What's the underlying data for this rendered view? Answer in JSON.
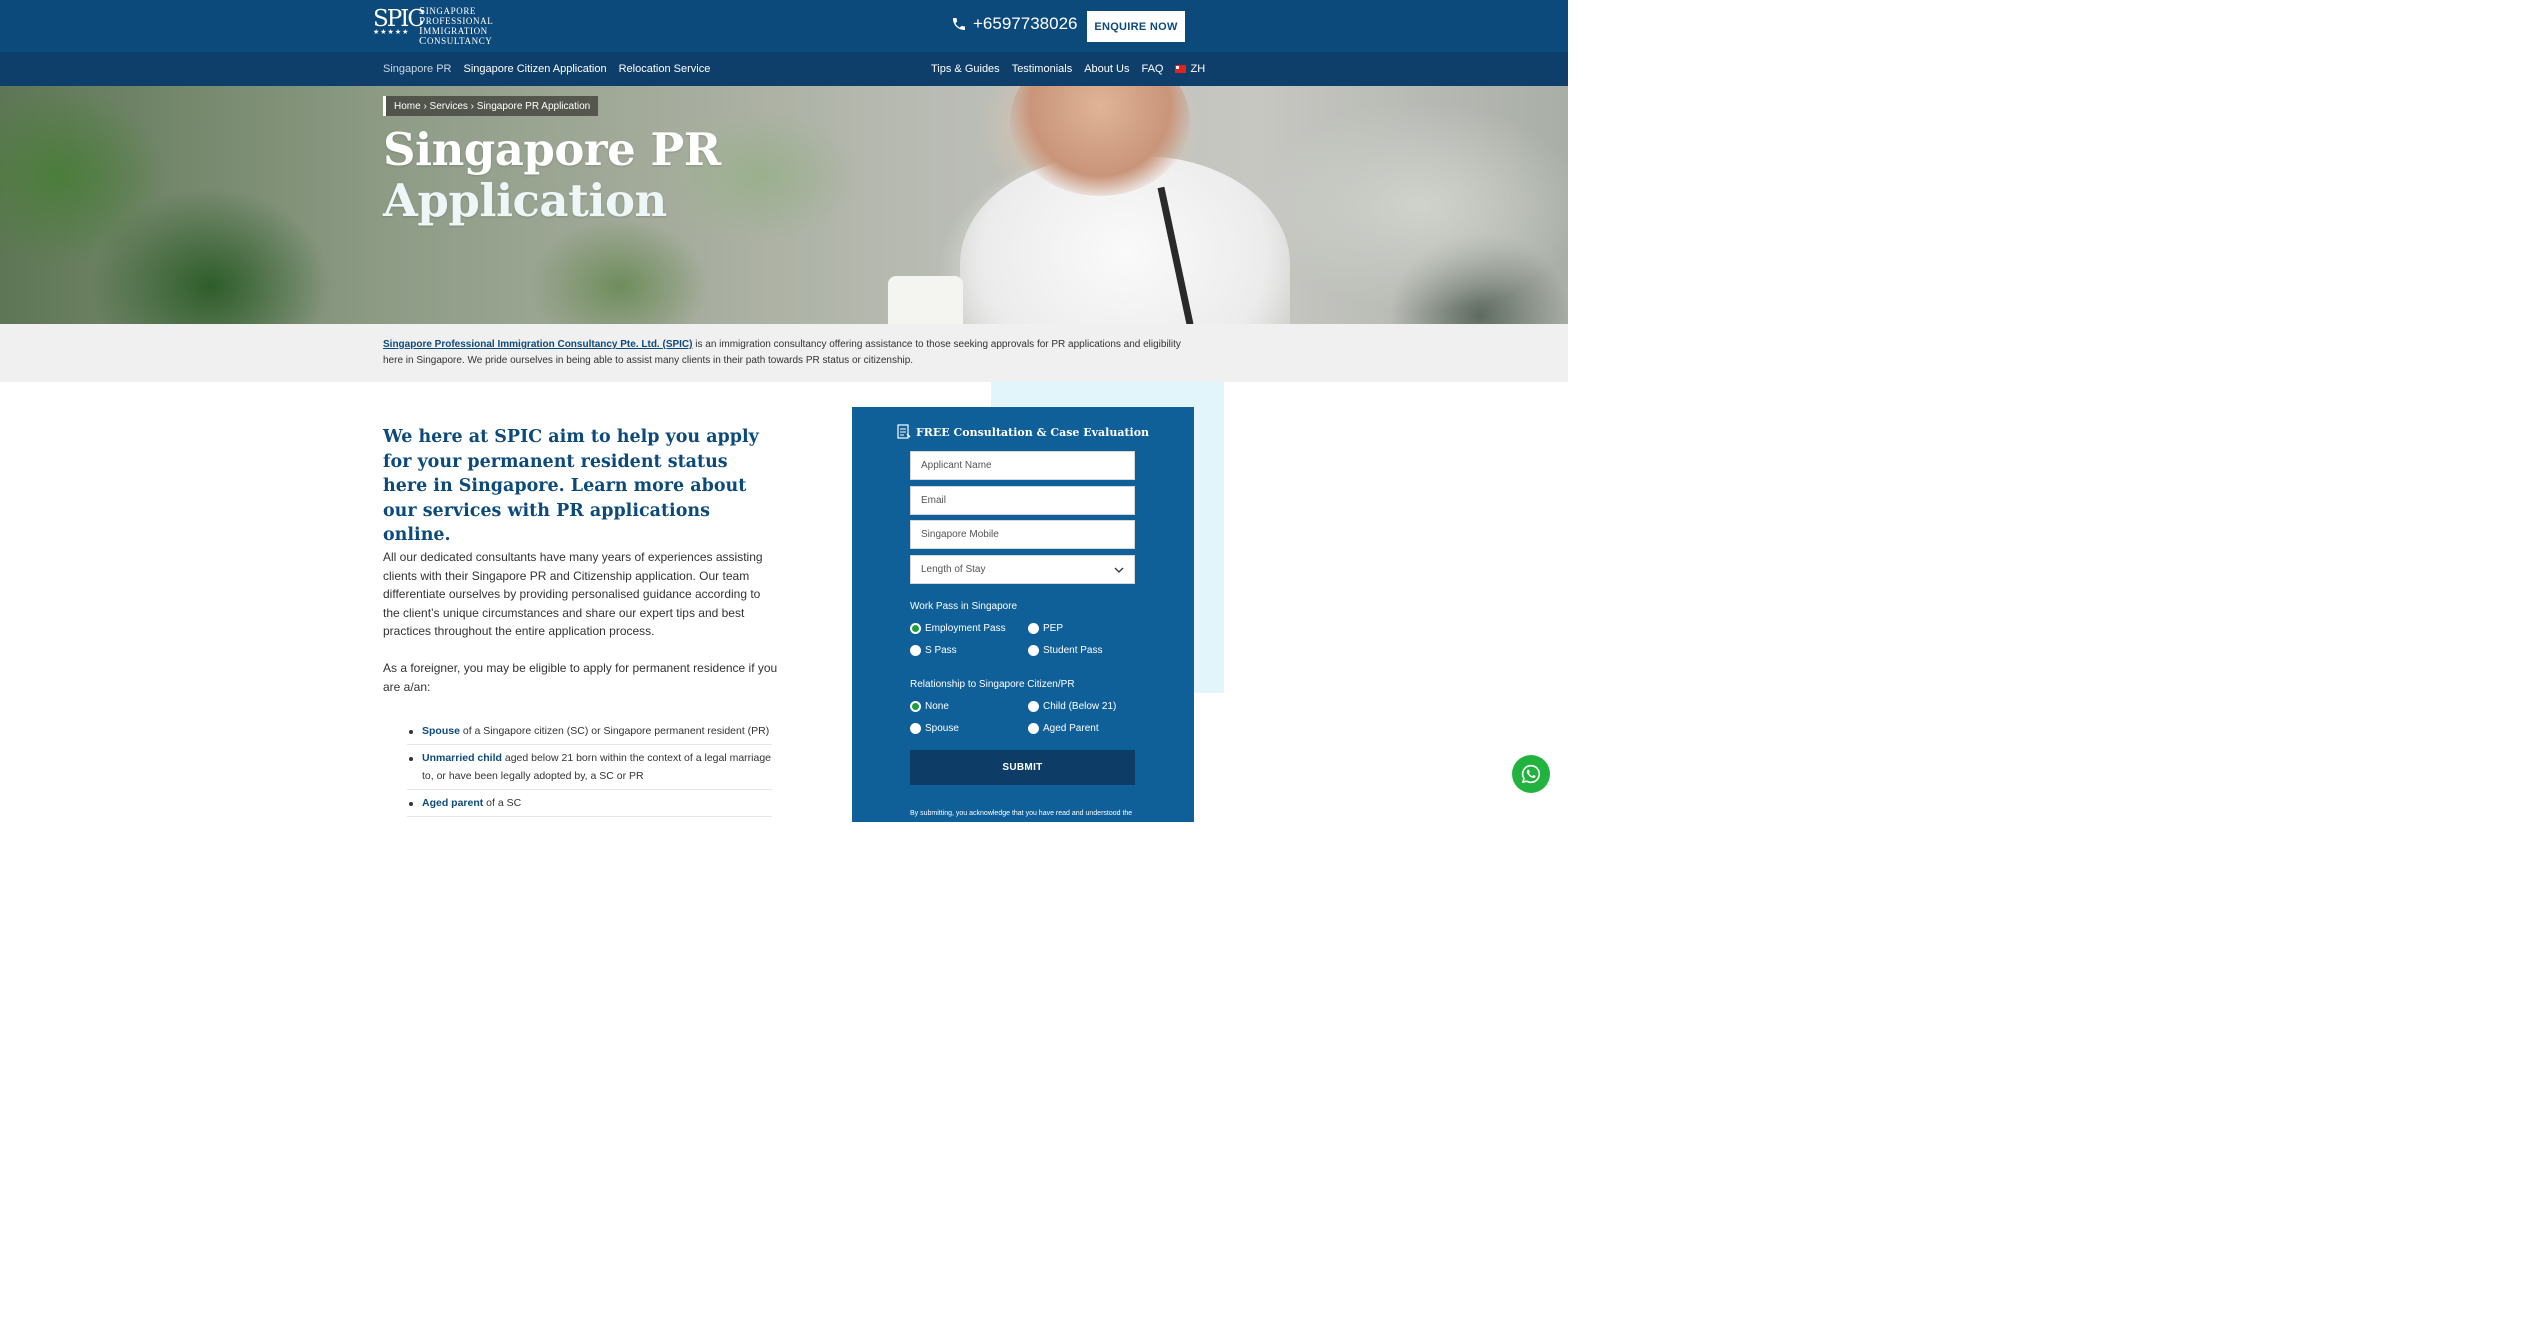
{
  "header": {
    "logo_monogram": "SPIC",
    "logo_lines": [
      "Singapore",
      "Professional",
      "Immigration",
      "Consultancy"
    ],
    "phone": "+6597738026",
    "enquire_label": "ENQUIRE NOW"
  },
  "nav": {
    "left": [
      "Singapore PR",
      "Singapore Citizen Application",
      "Relocation Service"
    ],
    "right": [
      "Tips & Guides",
      "Testimonials",
      "About Us",
      "FAQ"
    ],
    "lang": "ZH"
  },
  "breadcrumb": "Home › Services › Singapore PR Application",
  "hero": {
    "title_line1": "Singapore PR",
    "title_line2": "Application"
  },
  "intro": {
    "link": "Singapore Professional Immigration Consultancy Pte. Ltd. (SPIC)",
    "text": " is an immigration consultancy offering assistance to those seeking approvals for PR applications and eligibility here in Singapore. We pride ourselves in being able to assist many clients in their path towards PR status or citizenship."
  },
  "content": {
    "heading": "We here at SPIC aim to help you apply for your permanent resident status here in Singapore. Learn more about our services with PR applications online.",
    "para1": "All our dedicated consultants have many years of experiences assisting clients with their Singapore PR and Citizenship application. Our team differentiate ourselves by providing personalised guidance according to the client’s unique circumstances and share our expert tips and best practices throughout the entire application process.",
    "para2": "As a foreigner, you may be eligible to apply for permanent residence if you are a/an:",
    "list": [
      {
        "bold": "Spouse",
        "text": " of a Singapore citizen (SC) or Singapore permanent resident (PR)"
      },
      {
        "bold": "Unmarried child",
        "text": " aged below 21 born within the context of a legal marriage to, or have been legally adopted by, a SC or PR"
      },
      {
        "bold": "Aged parent",
        "text": " of a SC"
      }
    ]
  },
  "form": {
    "title": "FREE Consultation & Case Evaluation",
    "name_placeholder": "Applicant Name",
    "email_placeholder": "Email",
    "mobile_placeholder": "Singapore Mobile",
    "stay_select": "Length of Stay",
    "work_pass_label": "Work Pass in Singapore",
    "work_pass_options": [
      "Employment Pass",
      "PEP",
      "S Pass",
      "Student Pass"
    ],
    "work_pass_selected": "Employment Pass",
    "relationship_label": "Relationship to Singapore Citizen/PR",
    "relationship_options": [
      "None",
      "Child (Below 21)",
      "Spouse",
      "Aged Parent"
    ],
    "relationship_selected": "None",
    "submit_label": "SUBMIT",
    "disclaimer": "By submitting, you acknowledge that you have read and understood the"
  },
  "colors": {
    "brand_navy": "#0d4a7c",
    "form_blue": "#0f5f99",
    "accent_cyan": "#e1f5fa",
    "whatsapp_green": "#21b33d"
  }
}
